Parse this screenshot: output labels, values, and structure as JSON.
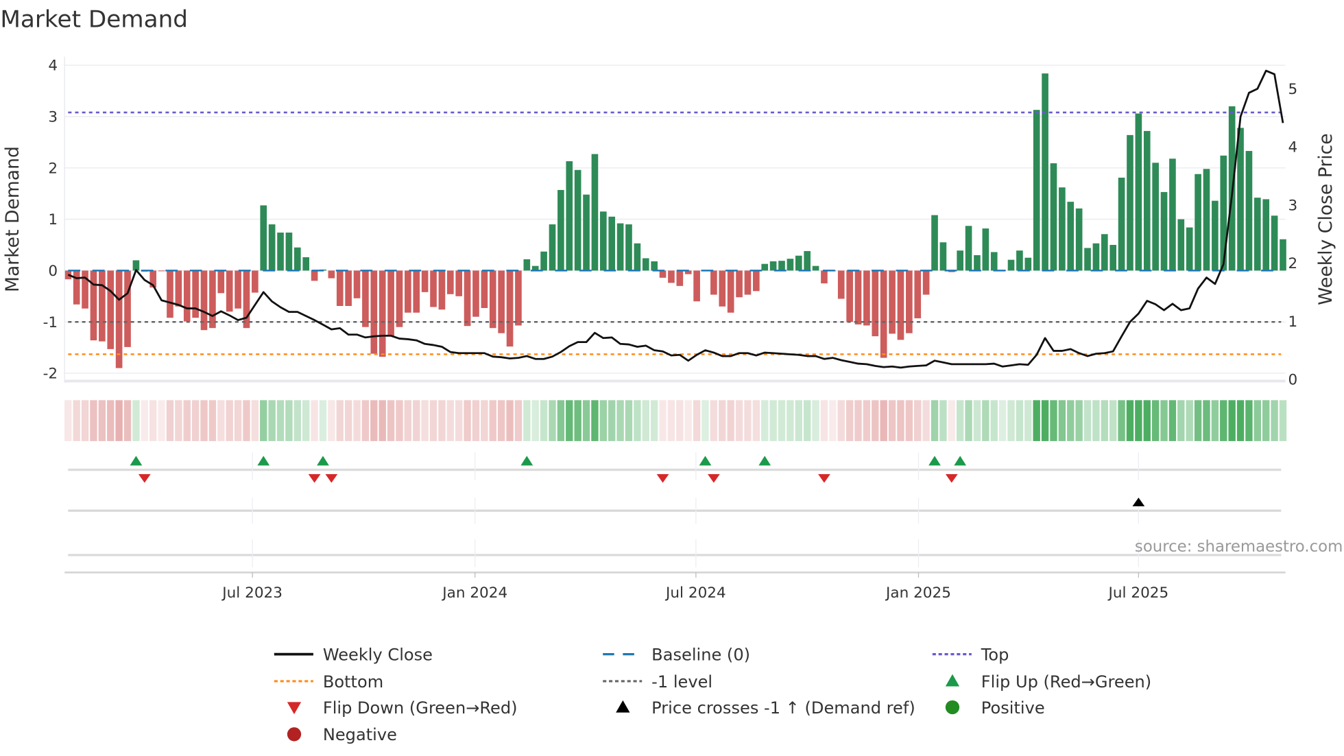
{
  "chart_data": {
    "type": "bar",
    "title": "Market Demand",
    "ylabel": "Market Demand",
    "y2label": "Weekly Close Price",
    "ylim": [
      -2.2,
      4.15
    ],
    "y2lim": [
      0,
      5.6
    ],
    "yticks": [
      "-2",
      "-1",
      "0",
      "1",
      "2",
      "3",
      "4"
    ],
    "y2ticks": [
      "0",
      "1",
      "2",
      "3",
      "4",
      "5"
    ],
    "xticks": [
      {
        "label": "Jul 2023",
        "index": 21.7
      },
      {
        "label": "Jan 2024",
        "index": 47.9
      },
      {
        "label": "Jul 2024",
        "index": 73.9
      },
      {
        "label": "Jan 2025",
        "index": 100.1
      },
      {
        "label": "Jul 2025",
        "index": 126.0
      }
    ],
    "grid": true,
    "levels": {
      "top": 3.08,
      "baseline": 0,
      "minus_one": -1,
      "bottom": -1.63
    },
    "demand": [
      -0.17,
      -0.66,
      -0.74,
      -1.36,
      -1.38,
      -1.53,
      -1.9,
      -1.49,
      0.2,
      -0.02,
      -0.33,
      -0.01,
      -0.92,
      -0.7,
      -0.99,
      -0.92,
      -1.16,
      -1.12,
      -0.44,
      -0.8,
      -0.74,
      -1.12,
      -0.43,
      1.27,
      0.9,
      0.74,
      0.74,
      0.45,
      0.26,
      -0.2,
      0.02,
      -0.15,
      -0.69,
      -0.69,
      -0.54,
      -1.1,
      -1.62,
      -1.68,
      -1.27,
      -1.1,
      -0.82,
      -0.82,
      -0.42,
      -0.71,
      -0.76,
      -0.46,
      -0.5,
      -1.08,
      -0.9,
      -0.73,
      -1.12,
      -1.22,
      -1.48,
      -1.07,
      0.22,
      0.09,
      0.37,
      0.9,
      1.57,
      2.13,
      1.96,
      1.48,
      2.27,
      1.15,
      1.05,
      0.92,
      0.9,
      0.53,
      0.24,
      0.18,
      -0.14,
      -0.24,
      -0.3,
      -0.07,
      -0.6,
      0.01,
      -0.47,
      -0.7,
      -0.82,
      -0.52,
      -0.47,
      -0.4,
      0.13,
      0.18,
      0.19,
      0.23,
      0.29,
      0.38,
      0.09,
      -0.25,
      -0.01,
      -0.55,
      -1.0,
      -1.05,
      -1.07,
      -1.28,
      -1.7,
      -1.23,
      -1.35,
      -1.22,
      -0.93,
      -0.47,
      1.08,
      0.55,
      -0.03,
      0.39,
      0.87,
      0.3,
      0.82,
      0.36,
      0.01,
      0.21,
      0.39,
      0.25,
      3.13,
      3.84,
      2.09,
      1.62,
      1.34,
      1.21,
      0.44,
      0.53,
      0.71,
      0.5,
      1.81,
      2.64,
      3.06,
      2.72,
      2.1,
      1.53,
      2.18,
      1.0,
      0.84,
      1.88,
      1.98,
      1.36,
      2.24,
      3.2,
      2.78,
      2.33,
      1.42,
      1.39,
      1.07,
      0.61
    ],
    "weekly_close": [
      1.8,
      1.74,
      1.75,
      1.63,
      1.62,
      1.52,
      1.37,
      1.48,
      1.88,
      1.71,
      1.62,
      1.36,
      1.32,
      1.28,
      1.22,
      1.22,
      1.16,
      1.09,
      1.17,
      1.1,
      1.02,
      1.06,
      1.28,
      1.5,
      1.34,
      1.24,
      1.16,
      1.16,
      1.09,
      1.02,
      0.94,
      0.86,
      0.88,
      0.77,
      0.77,
      0.72,
      0.74,
      0.75,
      0.75,
      0.7,
      0.69,
      0.67,
      0.61,
      0.59,
      0.56,
      0.47,
      0.45,
      0.45,
      0.45,
      0.45,
      0.39,
      0.38,
      0.36,
      0.37,
      0.4,
      0.35,
      0.35,
      0.39,
      0.47,
      0.57,
      0.64,
      0.64,
      0.8,
      0.71,
      0.72,
      0.61,
      0.6,
      0.56,
      0.58,
      0.5,
      0.48,
      0.41,
      0.42,
      0.32,
      0.42,
      0.5,
      0.46,
      0.4,
      0.4,
      0.45,
      0.45,
      0.41,
      0.46,
      0.45,
      0.44,
      0.43,
      0.42,
      0.4,
      0.4,
      0.35,
      0.37,
      0.33,
      0.3,
      0.27,
      0.26,
      0.23,
      0.21,
      0.22,
      0.2,
      0.22,
      0.23,
      0.24,
      0.32,
      0.29,
      0.26,
      0.26,
      0.26,
      0.26,
      0.26,
      0.27,
      0.22,
      0.24,
      0.26,
      0.25,
      0.42,
      0.71,
      0.49,
      0.49,
      0.52,
      0.45,
      0.4,
      0.44,
      0.45,
      0.48,
      0.74,
      0.99,
      1.13,
      1.35,
      1.29,
      1.19,
      1.3,
      1.19,
      1.22,
      1.56,
      1.75,
      1.64,
      1.98,
      3.18,
      4.52,
      4.93,
      5.0,
      5.31,
      5.25,
      4.41
    ],
    "flip_up_index": [
      8,
      23,
      30,
      54,
      75,
      82,
      102,
      105
    ],
    "flip_down_index": [
      9,
      29,
      31,
      70,
      76,
      89,
      104
    ],
    "price_cross_index": [
      126
    ],
    "legend_position": "bottom",
    "legend": [
      "Weekly Close",
      "Baseline (0)",
      "Top",
      "Bottom",
      "-1 level",
      "Flip Up (Red→Green)",
      "Flip Down (Green→Red)",
      "Price crosses -1 ↑ (Demand ref)",
      "Positive",
      "Negative"
    ],
    "colors": {
      "positive": "#2e8b57",
      "negative": "#cd5c5c",
      "line": "#111111",
      "baseline": "#1f77b4",
      "top": "#6a5acd",
      "bottom": "#ff8c1a",
      "minus_one": "#666666",
      "flip_up": "#1a9a4a",
      "flip_down": "#d62728",
      "cross": "#000000",
      "pos_dot": "#228b22",
      "neg_dot": "#b22222"
    }
  },
  "source": "source: sharemaestro.com"
}
